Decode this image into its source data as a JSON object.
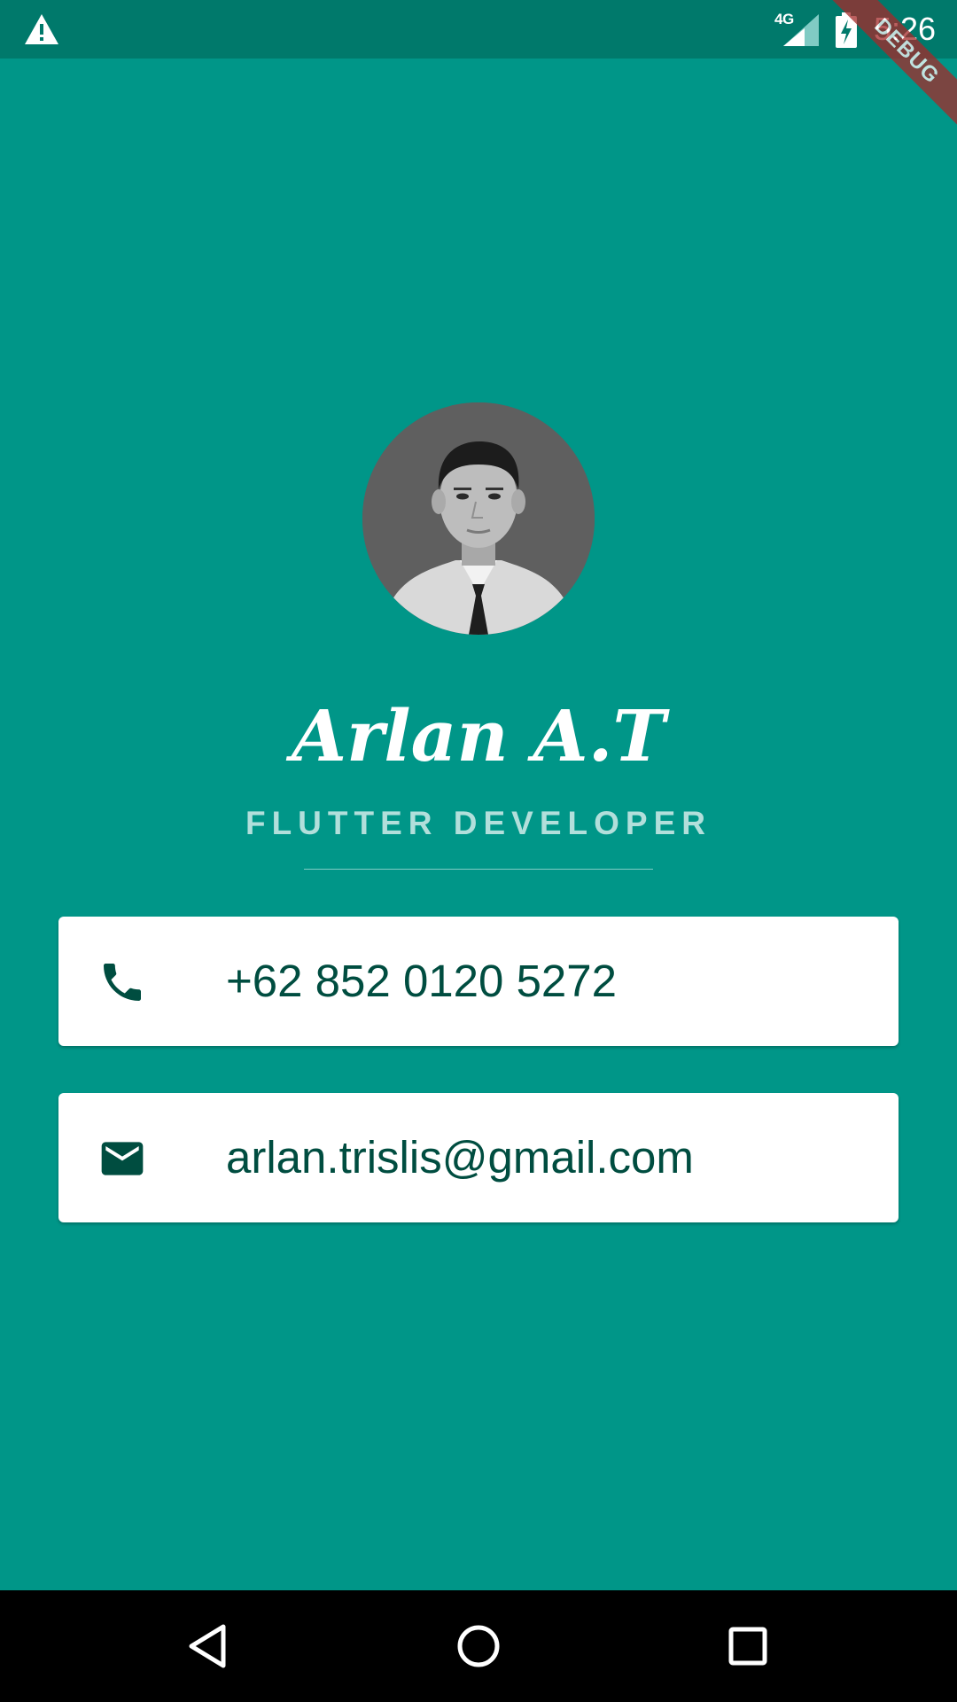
{
  "status_bar": {
    "network_label": "4G",
    "time": "5:26",
    "background_color": "#00796b",
    "icons": [
      "warning-icon",
      "signal-icon",
      "battery-charging-icon"
    ]
  },
  "debug_banner": {
    "label": "DEBUG",
    "color": "#a52a2a"
  },
  "profile": {
    "name": "Arlan A.T",
    "role": "FLUTTER DEVELOPER",
    "avatar": "profile-photo"
  },
  "contacts": {
    "phone": {
      "icon": "phone-icon",
      "value": "+62 852 0120 5272"
    },
    "email": {
      "icon": "mail-icon",
      "value": "arlan.trislis@gmail.com"
    }
  },
  "navigation": {
    "buttons": [
      "back-icon",
      "home-icon",
      "recent-apps-icon"
    ]
  },
  "theme": {
    "background": "#009688",
    "role_text": "#b2dfdb",
    "card_text": "#004d40",
    "card_background": "#ffffff"
  }
}
